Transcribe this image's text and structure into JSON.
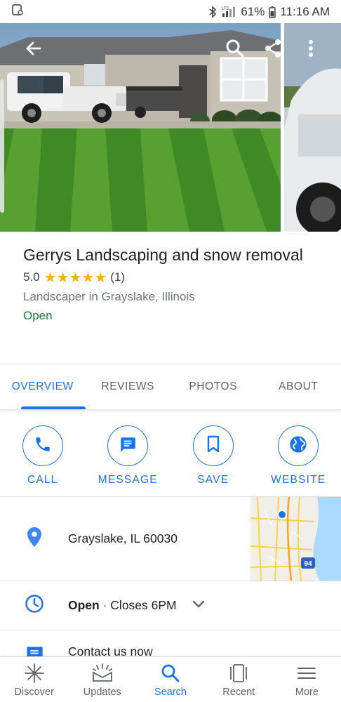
{
  "status_bar": {
    "battery": "61%",
    "time": "11:16 AM",
    "network": "LTE"
  },
  "place": {
    "title": "Gerrys Landscaping and snow removal",
    "rating": "5.0",
    "stars": "★★★★★",
    "review_count": "(1)",
    "category": "Landscaper in Grayslake, Illinois",
    "open_status": "Open"
  },
  "tabs": [
    {
      "label": "OVERVIEW",
      "active": true
    },
    {
      "label": "REVIEWS",
      "active": false
    },
    {
      "label": "PHOTOS",
      "active": false
    },
    {
      "label": "ABOUT",
      "active": false
    }
  ],
  "actions": [
    {
      "label": "CALL",
      "icon": "phone-icon"
    },
    {
      "label": "MESSAGE",
      "icon": "message-icon"
    },
    {
      "label": "SAVE",
      "icon": "bookmark-icon"
    },
    {
      "label": "WEBSITE",
      "icon": "globe-icon"
    }
  ],
  "address": {
    "text": "Grayslake, IL 60030",
    "map_shield": "94"
  },
  "hours": {
    "open": "Open",
    "separator": " · ",
    "closes": "Closes 6PM"
  },
  "contact": {
    "text": "Contact us now"
  },
  "bottom_nav": [
    {
      "label": "Discover",
      "icon": "discover-icon",
      "active": false
    },
    {
      "label": "Updates",
      "icon": "updates-icon",
      "active": false
    },
    {
      "label": "Search",
      "icon": "search-icon",
      "active": true
    },
    {
      "label": "Recent",
      "icon": "recent-icon",
      "active": false
    },
    {
      "label": "More",
      "icon": "menu-icon",
      "active": false
    }
  ],
  "colors": {
    "accent": "#1a73e8",
    "open_green": "#188038",
    "star_gold": "#f5b400",
    "location_pin": "#4285f4"
  }
}
